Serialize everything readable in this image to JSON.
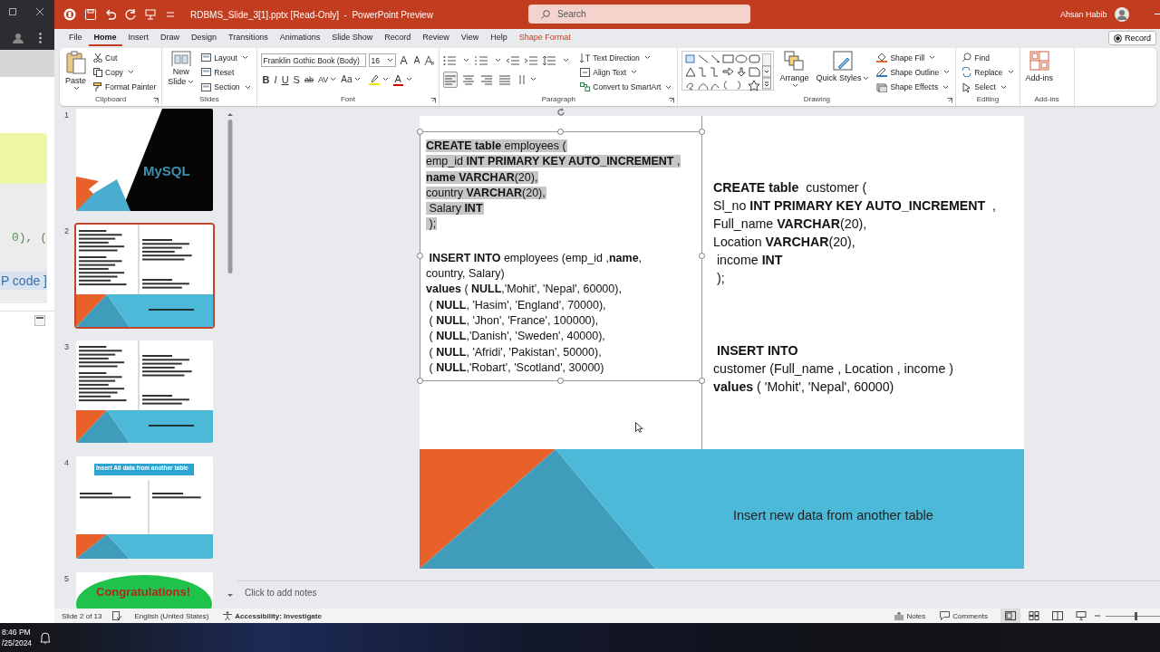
{
  "side_window": {
    "code_lines": [
      "0), (",
      "P code ]"
    ]
  },
  "title_bar": {
    "file_title": "RDBMS_Slide_3[1].pptx [Read-Only]  -  PowerPoint Preview",
    "search_placeholder": "Search",
    "user_name": "Ahsan Habib"
  },
  "menu_tabs": [
    {
      "label": "File",
      "kind": "normal",
      "selected": false
    },
    {
      "label": "Home",
      "kind": "normal",
      "selected": true
    },
    {
      "label": "Insert",
      "kind": "normal",
      "selected": false
    },
    {
      "label": "Draw",
      "kind": "normal",
      "selected": false
    },
    {
      "label": "Design",
      "kind": "normal",
      "selected": false
    },
    {
      "label": "Transitions",
      "kind": "normal",
      "selected": false
    },
    {
      "label": "Animations",
      "kind": "normal",
      "selected": false
    },
    {
      "label": "Slide Show",
      "kind": "normal",
      "selected": false
    },
    {
      "label": "Record",
      "kind": "normal",
      "selected": false
    },
    {
      "label": "Review",
      "kind": "normal",
      "selected": false
    },
    {
      "label": "View",
      "kind": "normal",
      "selected": false
    },
    {
      "label": "Help",
      "kind": "normal",
      "selected": false
    },
    {
      "label": "Shape Format",
      "kind": "contextual",
      "selected": false
    }
  ],
  "record_button": "Record",
  "ribbon": {
    "clipboard": {
      "title": "Clipboard",
      "paste": "Paste",
      "commands": [
        "Cut",
        "Copy",
        "Format Painter"
      ]
    },
    "slides": {
      "title": "Slides",
      "new_slide": [
        "New",
        "Slide"
      ],
      "commands": [
        "Layout",
        "Reset",
        "Section"
      ]
    },
    "font": {
      "title": "Font",
      "font_name": "Franklin Gothic Book (Body)",
      "font_size": "16",
      "size_buttons": [
        "A",
        "A"
      ],
      "format_buttons": [
        "B",
        "I",
        "U",
        "S",
        "ab",
        "AV",
        "Aa"
      ],
      "font_color": "A"
    },
    "paragraph": {
      "title": "Paragraph",
      "align_buttons": [
        {
          "kind": "left",
          "selected": true
        },
        {
          "kind": "center",
          "selected": false
        },
        {
          "kind": "right",
          "selected": false
        },
        {
          "kind": "justify",
          "selected": false
        }
      ],
      "commands": [
        "Text Direction",
        "Align Text",
        "Convert to SmartArt"
      ]
    },
    "drawing": {
      "title": "Drawing",
      "large": [
        "Arrange",
        "Quick Styles"
      ],
      "commands": [
        "Shape Fill",
        "Shape Outline",
        "Shape Effects"
      ]
    },
    "editing": {
      "title": "Editing",
      "commands": [
        "Find",
        "Replace",
        "Select"
      ]
    },
    "addins": {
      "title": "Add-ins",
      "label": "Add-ins"
    }
  },
  "thumbnails": [
    {
      "number": "1",
      "kind": "title",
      "selected": false,
      "heading": "MySQL"
    },
    {
      "number": "2",
      "kind": "code",
      "selected": true
    },
    {
      "number": "3",
      "kind": "code",
      "selected": false
    },
    {
      "number": "4",
      "kind": "banner",
      "selected": false,
      "heading": "Insert All data from another table"
    },
    {
      "number": "5",
      "kind": "congrats",
      "selected": false,
      "heading": "Congratulations!"
    }
  ],
  "slide": {
    "left_box": [
      {
        "highlighted": true,
        "lines": [
          "**CREATE table** employees (",
          "emp_id **INT PRIMARY KEY AUTO_INCREMENT** ,",
          "**name VARCHAR**(20),",
          "country **VARCHAR**(20),",
          " Salary **INT**",
          " );"
        ]
      },
      {
        "highlighted": false,
        "lines": [
          " **INSERT INTO** employees (emp_id ,**name**,",
          "country, Salary)",
          "**values** ( **NULL**,'Mohit', 'Nepal', 60000),",
          " ( **NULL**, 'Hasim', 'England', 70000),",
          " ( **NULL**, 'Jhon', 'France', 100000),",
          " ( **NULL**,'Danish', 'Sweden', 40000),",
          " ( **NULL**, 'Afridi', 'Pakistan', 50000),",
          " ( **NULL**,'Robart', 'Scotland', 30000)"
        ]
      }
    ],
    "right_box": [
      {
        "highlighted": false,
        "lines": [
          "**CREATE table**  customer (",
          "Sl_no **INT PRIMARY KEY AUTO_INCREMENT**  ,",
          "Full_name **VARCHAR**(20),",
          "Location **VARCHAR**(20),",
          " income **INT**",
          " );"
        ]
      },
      {
        "highlighted": false,
        "lines": [
          " **INSERT INTO**",
          "customer (Full_name , Location , income )",
          "**values** ( 'Mohit', 'Nepal', 60000)"
        ]
      }
    ],
    "footer": "Insert new data from another table"
  },
  "notes_placeholder": "Click to add notes",
  "status_bar": {
    "slide_count": "Slide 2 of 13",
    "language": "English (United States)",
    "accessibility": "Accessibility: Investigate",
    "notes": "Notes",
    "comments": "Comments",
    "views": [
      {
        "kind": "normal",
        "selected": true
      },
      {
        "kind": "sorter",
        "selected": false
      },
      {
        "kind": "reading",
        "selected": false
      },
      {
        "kind": "slideshow",
        "selected": false
      }
    ],
    "zoom": {
      "level": 0.55
    }
  },
  "taskbar": {
    "time": "8:46 PM",
    "date": "/25/2024"
  }
}
